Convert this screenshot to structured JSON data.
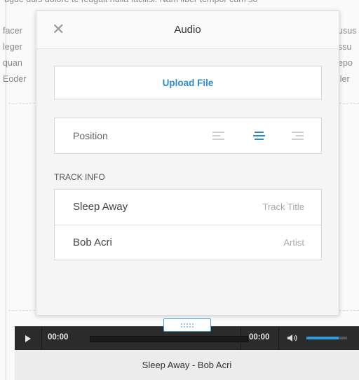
{
  "background_text": {
    "top_line": "ugue duis dolore te feugait nulla facilisi. Nam liber tempor cum so",
    "left_words": [
      "facer",
      "leger",
      "quan",
      "Eoder"
    ],
    "right_words": [
      "usus",
      "ssu",
      "epo",
      "ller"
    ]
  },
  "modal": {
    "title": "Audio",
    "close_glyph": "✕",
    "upload_label": "Upload File",
    "position_label": "Position",
    "alignment_options": [
      "left",
      "center",
      "right"
    ],
    "alignment_selected": "center",
    "section_label": "TRACK INFO",
    "track_title": {
      "value": "Sleep Away",
      "hint": "Track Title"
    },
    "artist": {
      "value": "Bob Acri",
      "hint": "Artist"
    }
  },
  "player": {
    "current_time": "00:00",
    "duration": "00:00",
    "volume_level": 0.8,
    "caption": "Sleep Away - Bob Acri",
    "icons": [
      "play-icon",
      "volume-icon",
      "drag-grip-icon"
    ]
  },
  "colors": {
    "accent": "#2d8ccb",
    "player_bg": "#2b2b2b",
    "volume_fill": "#2d9ee0"
  }
}
